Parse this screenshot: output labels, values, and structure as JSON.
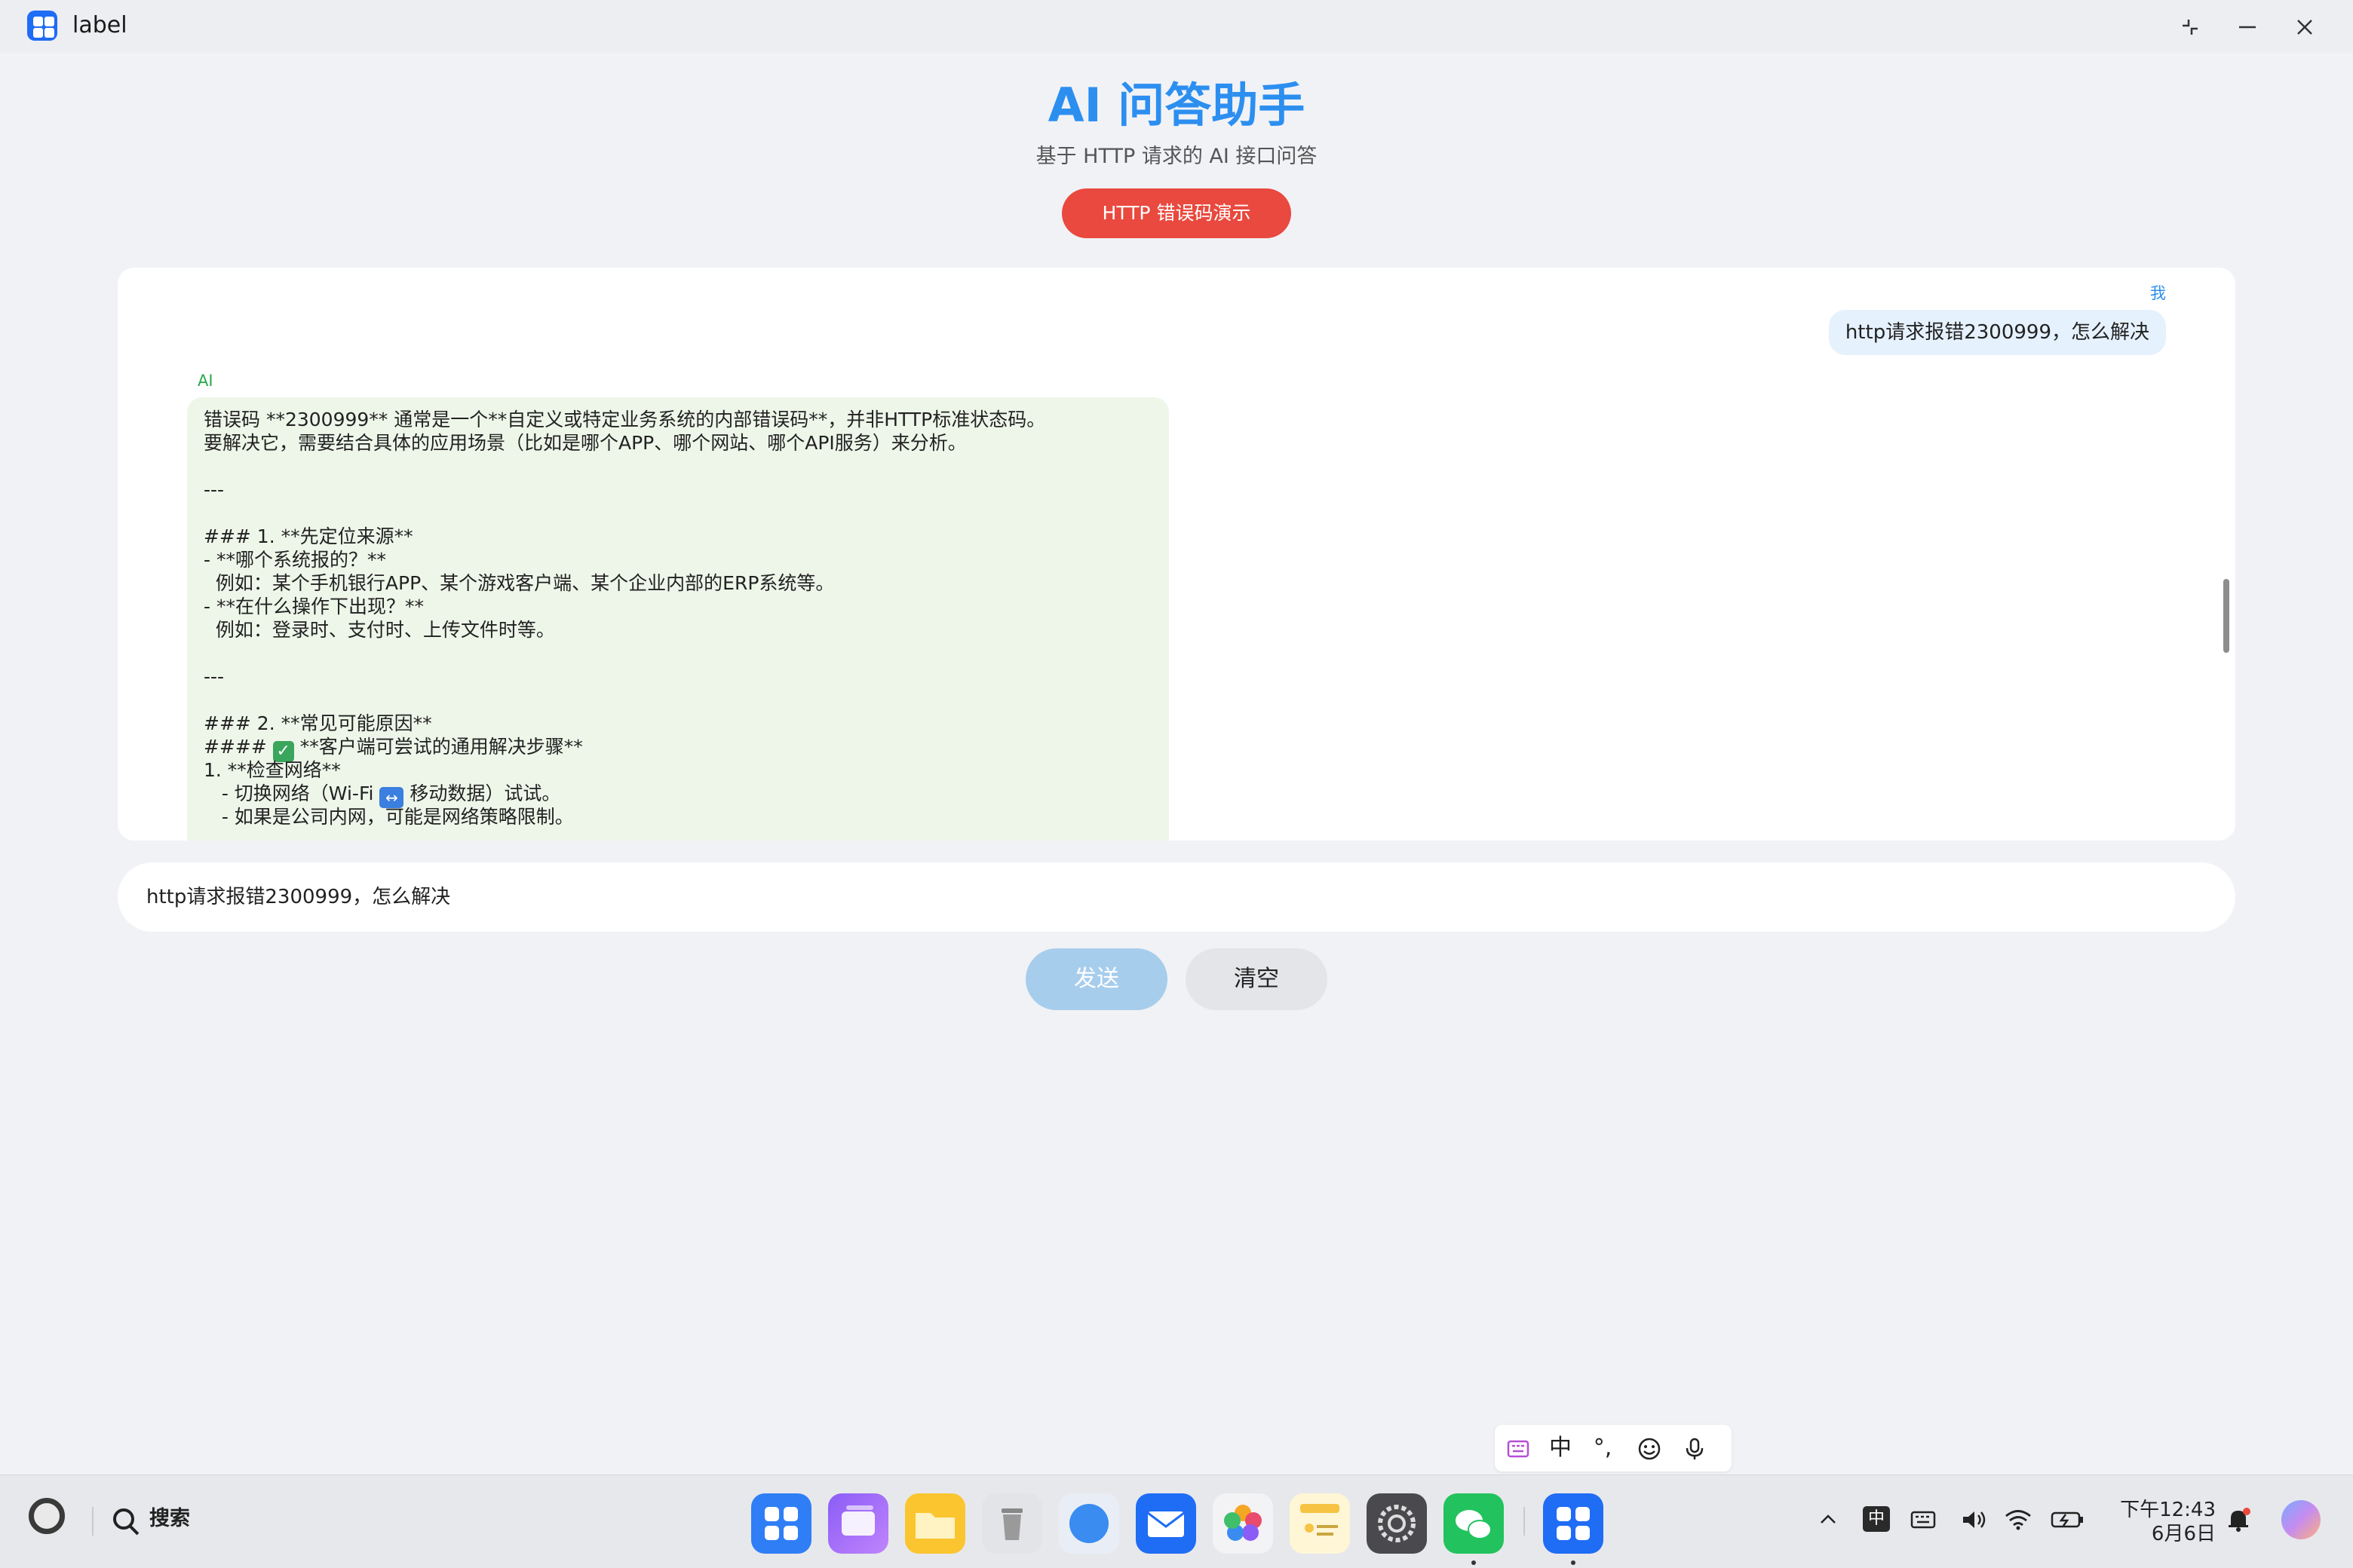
{
  "window": {
    "title": "label"
  },
  "header": {
    "title": "AI 问答助手",
    "subtitle": "基于 HTTP 请求的 AI 接口问答",
    "demo_button": "HTTP 错误码演示"
  },
  "chat": {
    "user_label": "我",
    "user_message": "http请求报错2300999，怎么解决",
    "ai_label": "AI",
    "ai_lines": [
      "错误码 **2300999** 通常是一个**自定义或特定业务系统的内部错误码**，并非HTTP标准状态码。",
      "要解决它，需要结合具体的应用场景（比如是哪个APP、哪个网站、哪个API服务）来分析。",
      "",
      "---",
      "",
      "### 1. **先定位来源**",
      "- **哪个系统报的？**",
      "  例如：某个手机银行APP、某个游戏客户端、某个企业内部的ERP系统等。",
      "- **在什么操作下出现？**",
      "  例如：登录时、支付时、上传文件时等。",
      "",
      "---",
      "",
      "### 2. **常见可能原因**",
      "#### ",
      "1. **检查网络**",
      "   - 切换网络（Wi-Fi ",
      "   - 如果是公司内网，可能是网络策略限制。"
    ],
    "ai_line_15_tail": " **客户端可尝试的通用解决步骤**",
    "ai_line_17_tail": " 移动数据）试试。"
  },
  "input": {
    "value": "http请求报错2300999，怎么解决"
  },
  "actions": {
    "send": "发送",
    "clear": "清空"
  },
  "ime": {
    "mode": "中",
    "punct": "°,"
  },
  "taskbar": {
    "search_label": "搜索",
    "tray_ime": "中",
    "clock_time": "下午12:43",
    "clock_date": "6月6日"
  },
  "colors": {
    "accent": "#2c8ff0",
    "danger": "#e9493e",
    "ai_bubble": "#eef6e9",
    "user_bubble": "#e5f1fd",
    "send_disabled": "#a7cdec"
  },
  "icons": {
    "dock": [
      "app-grid-icon",
      "multitask-icon",
      "files-icon",
      "trash-icon",
      "browser-icon",
      "mail-icon",
      "photos-icon",
      "notes-icon",
      "settings-icon",
      "wechat-icon",
      "label-app-icon"
    ]
  }
}
